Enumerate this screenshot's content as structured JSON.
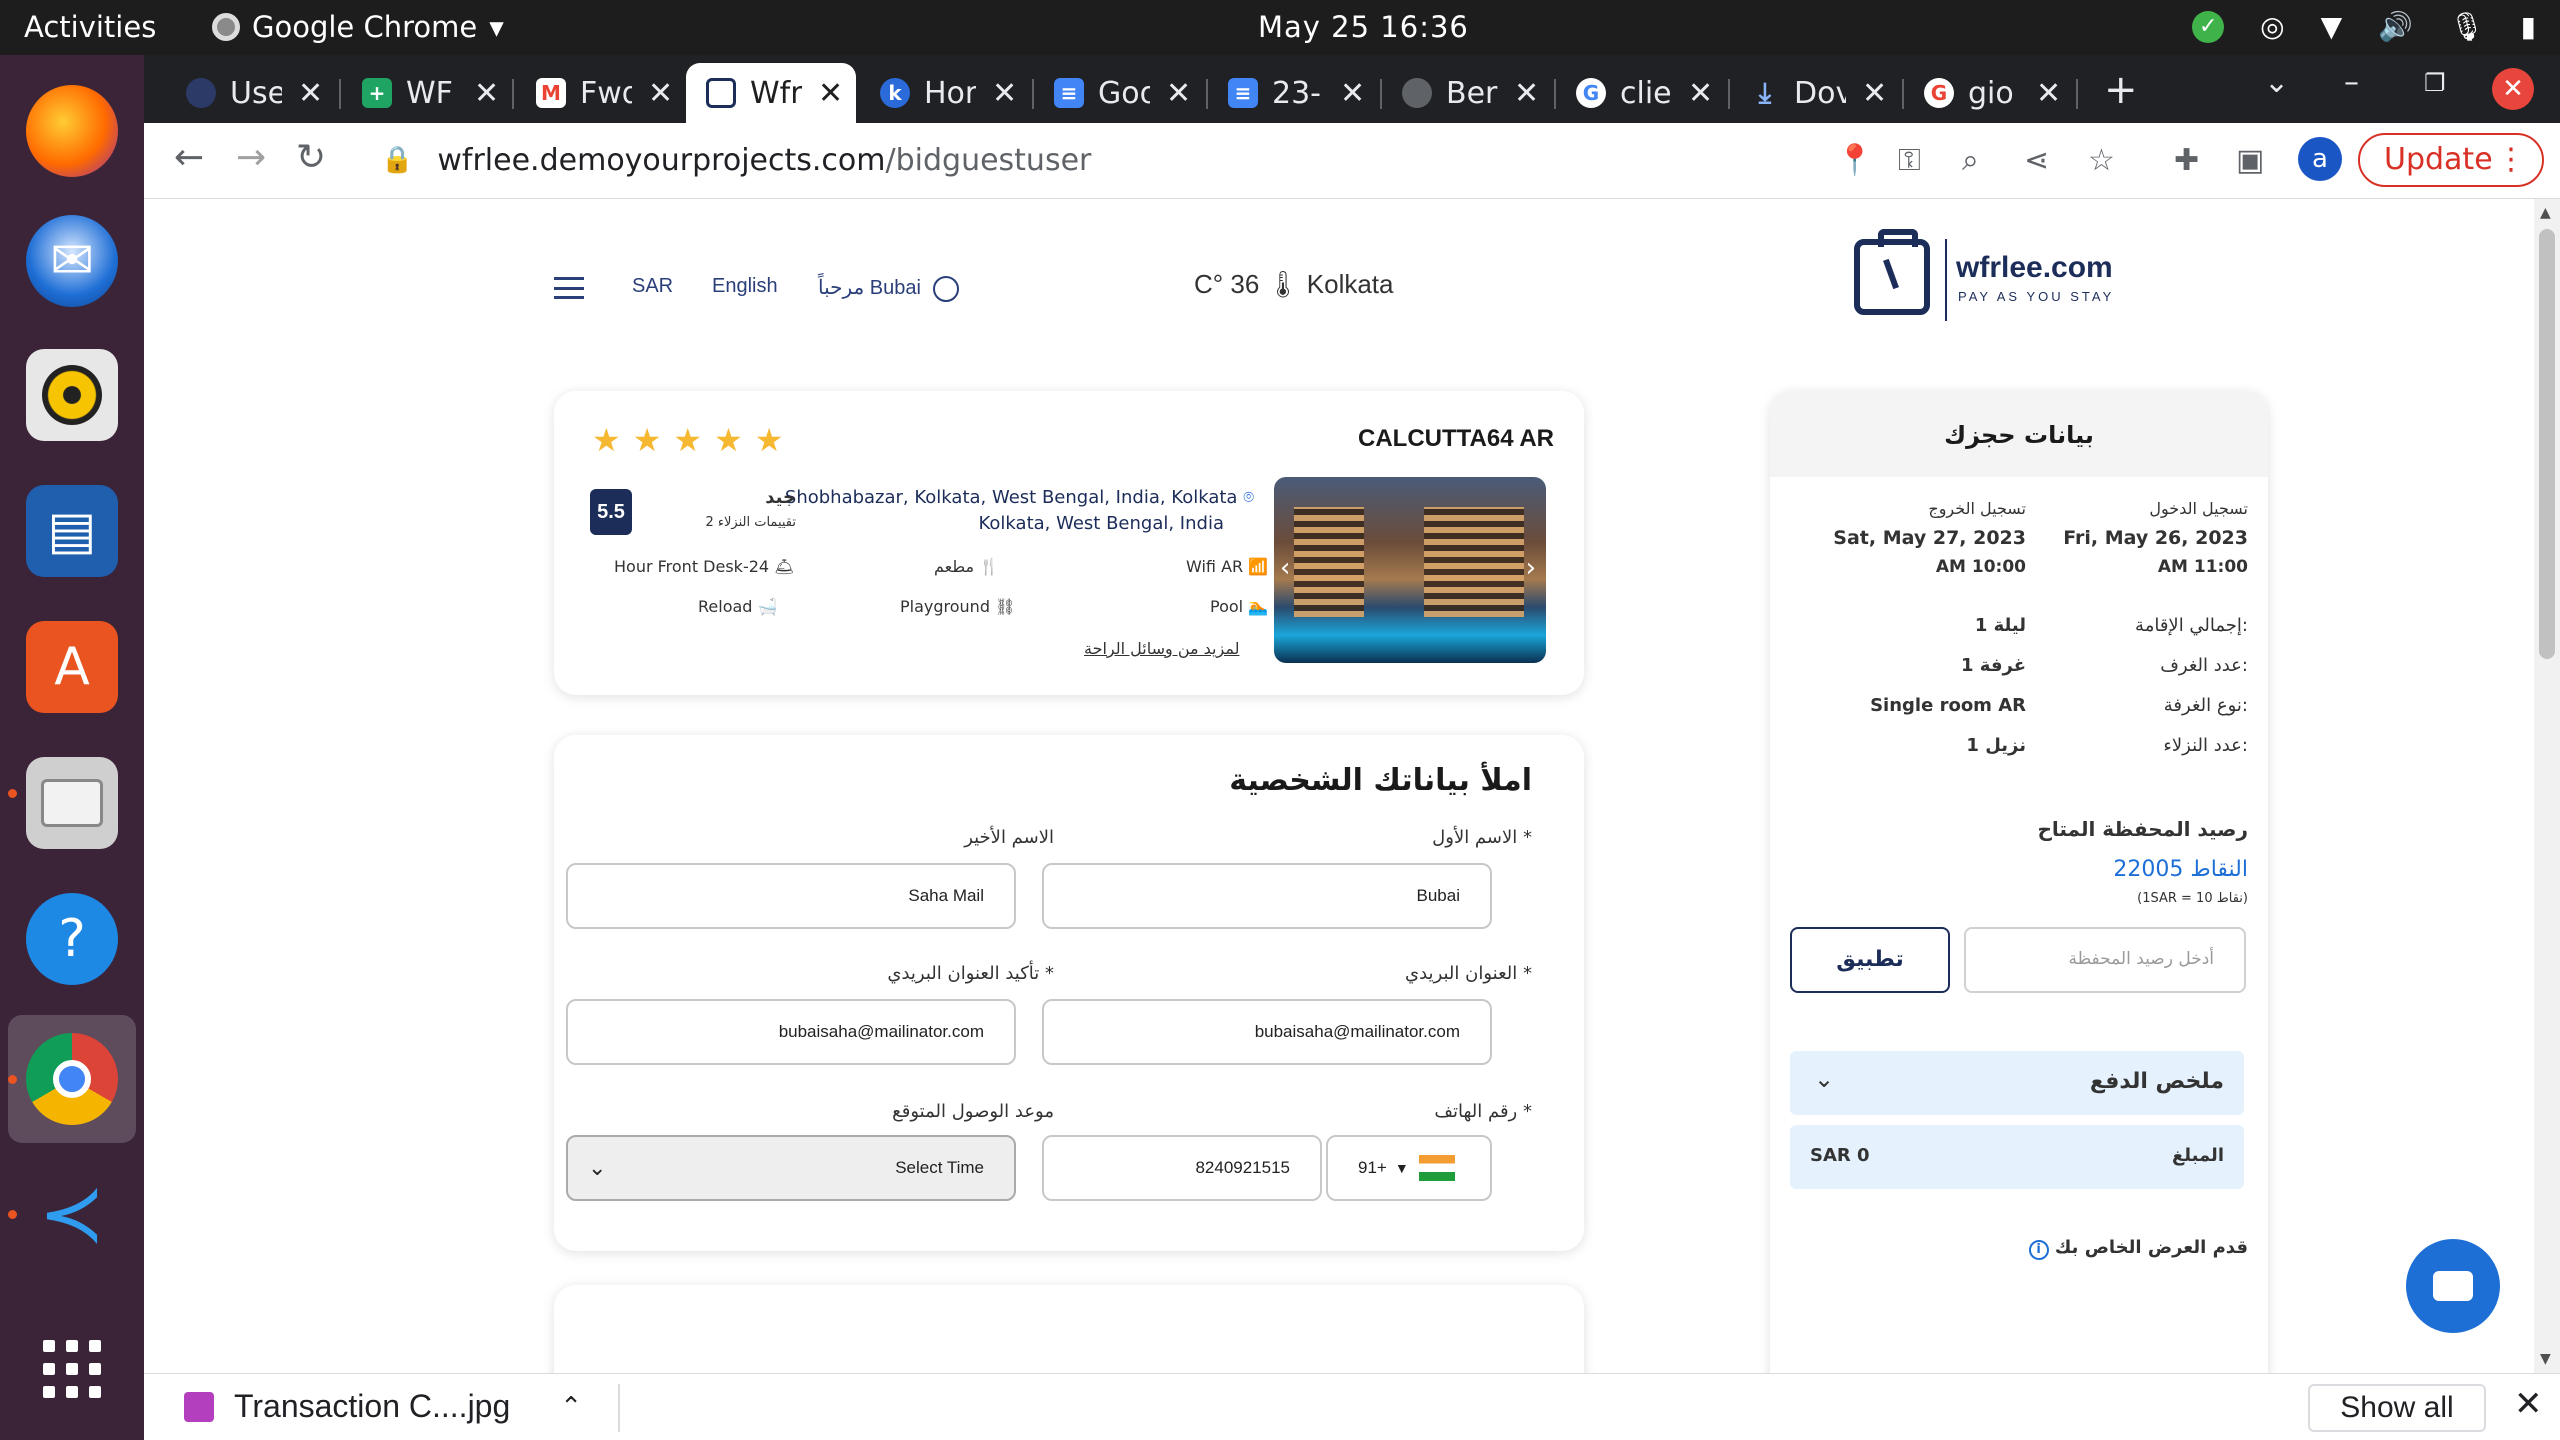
{
  "os": {
    "activities": "Activities",
    "app_name": "Google Chrome",
    "clock": "May 25  16:36"
  },
  "browser": {
    "tabs": [
      {
        "title": "Use",
        "fav_color": "#2b3a67"
      },
      {
        "title": "WF",
        "fav_color": "#1fa463"
      },
      {
        "title": "Fwd",
        "fav_color": "#ea4335"
      },
      {
        "title": "Wfr",
        "fav_color": "#1c2d5a",
        "active": true
      },
      {
        "title": "Hor",
        "fav_color": "#2a6ad9"
      },
      {
        "title": "Goo",
        "fav_color": "#4285f4"
      },
      {
        "title": "23-",
        "fav_color": "#4285f4"
      },
      {
        "title": "Ber",
        "fav_color": "#555555"
      },
      {
        "title": "clie",
        "fav_color": "#ea4335"
      },
      {
        "title": "Dov",
        "fav_color": "#4285f4"
      },
      {
        "title": "gio",
        "fav_color": "#ea4335"
      }
    ],
    "url_domain": "wfrlee.demoyourprojects.com",
    "url_path": "/bidguestuser",
    "profile_initial": "a",
    "update_label": "Update"
  },
  "site": {
    "currency": "SAR",
    "language": "English",
    "greeting": "مرحباً Bubai",
    "weather": "C° 36 🌡 Kolkata",
    "logo_name": "wfrlee.com",
    "logo_tag": "PAY AS YOU STAY"
  },
  "hotel": {
    "name": "CALCUTTA64 AR",
    "stars": 5,
    "address_line1": "Shobhabazar, Kolkata, West Bengal, India, Kolkata",
    "address_line2": "Kolkata, West Bengal, India",
    "score": "5.5",
    "rating_word": "جيد",
    "reviews": "2 تقييمات النزلاء",
    "amenities": {
      "desk": "Hour Front Desk-24",
      "restaurant": "مطعم",
      "wifi": "Wifi AR",
      "reload": "Reload",
      "playground": "Playground",
      "pool": "Pool"
    },
    "more_amenities": "لمزيد من وسائل الراحة"
  },
  "form": {
    "title": "املأ بياناتك الشخصية",
    "first_name_label": "الاسم الأول *",
    "first_name": "Bubai",
    "last_name_label": "الاسم الأخير",
    "last_name": "Saha Mail",
    "email_label": "العنوان البريدي *",
    "email": "bubaisaha@mailinator.com",
    "email_confirm_label": "تأكيد العنوان البريدي *",
    "email_confirm": "bubaisaha@mailinator.com",
    "phone_label": "رقم الهاتف *",
    "phone_code": "91+",
    "phone": "8240921515",
    "arrival_label": "موعد الوصول المتوقع",
    "arrival_value": "Select Time"
  },
  "booking": {
    "title": "بيانات حجزك",
    "checkin_label": "تسجيل الدخول",
    "checkin_date": "Fri, May 26, 2023",
    "checkin_time": "AM 11:00",
    "checkout_label": "تسجيل الخروج",
    "checkout_date": "Sat, May 27, 2023",
    "checkout_time": "AM 10:00",
    "stay_label": "إجمالي الإقامة:",
    "stay_value": "1 ليلة",
    "rooms_label": "عدد الغرف:",
    "rooms_value": "1 غرفة",
    "roomtype_label": "نوع الغرفة:",
    "roomtype_value": "Single room AR",
    "guests_label": "عدد النزلاء:",
    "guests_value": "1 نزيل",
    "wallet_title": "رصيد المحفظة المتاح",
    "wallet_points": "22005 النقاط",
    "wallet_rate": "(1SAR = 10 نقاط)",
    "wallet_placeholder": "أدخل رصيد المحفظة",
    "apply_label": "تطبيق",
    "payment_summary": "ملخص الدفع",
    "amount_label": "المبلغ",
    "amount_value": "SAR 0",
    "offer_label": "قدم العرض الخاص بك"
  },
  "downloads": {
    "file": "Transaction C....jpg",
    "show_all": "Show all"
  }
}
